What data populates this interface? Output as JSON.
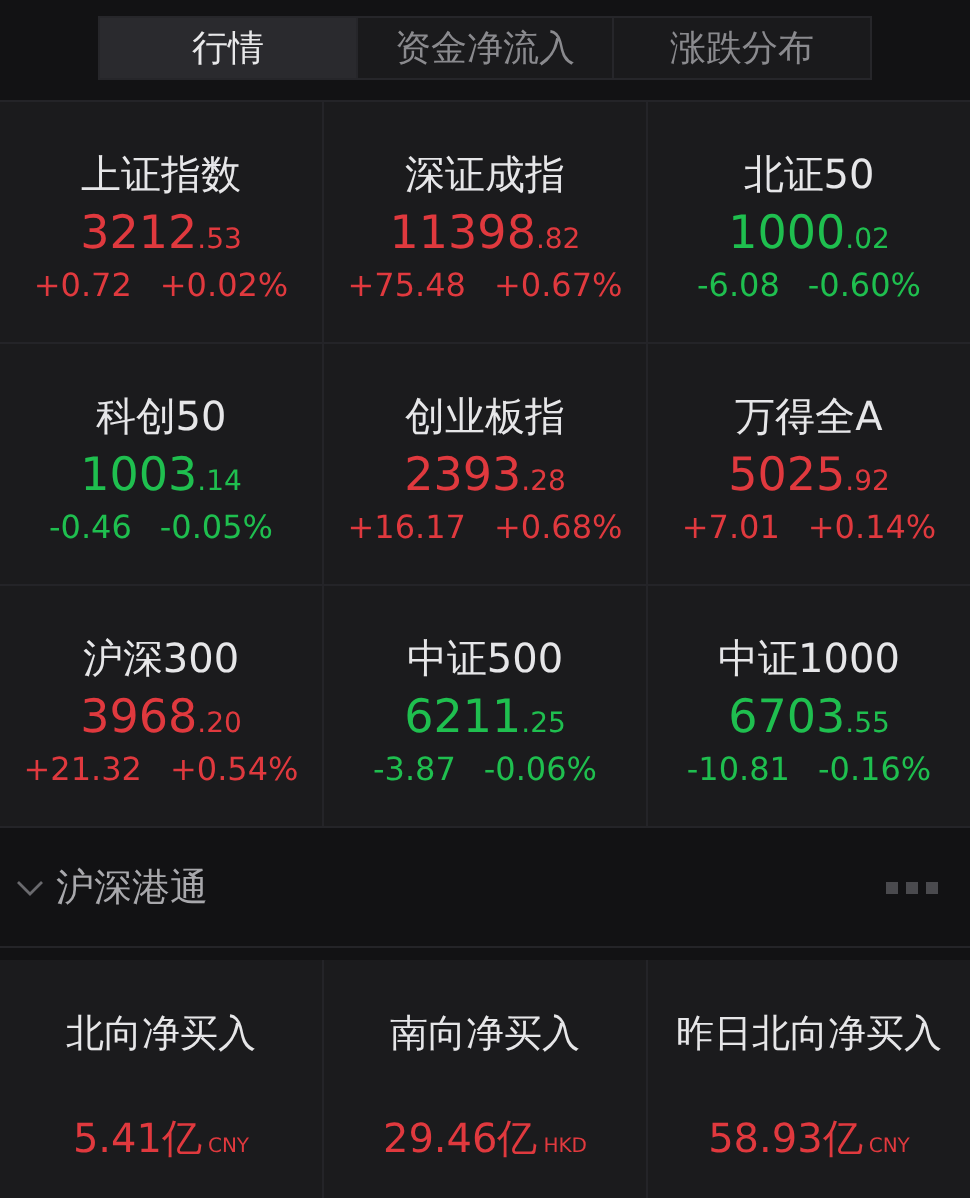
{
  "tabs": [
    {
      "label": "行情",
      "selected": true
    },
    {
      "label": "资金净流入",
      "selected": false
    },
    {
      "label": "涨跌分布",
      "selected": false
    }
  ],
  "indices": [
    {
      "name": "上证指数",
      "price": "3212",
      "price_decimal": ".53",
      "change": "+0.72",
      "percent": "+0.02%",
      "color": "#e0393e"
    },
    {
      "name": "深证成指",
      "price": "11398",
      "price_decimal": ".82",
      "change": "+75.48",
      "percent": "+0.67%",
      "color": "#e0393e"
    },
    {
      "name": "北证50",
      "price": "1000",
      "price_decimal": ".02",
      "change": "-6.08",
      "percent": "-0.60%",
      "color": "#1fbf4f"
    },
    {
      "name": "科创50",
      "price": "1003",
      "price_decimal": ".14",
      "change": "-0.46",
      "percent": "-0.05%",
      "color": "#1fbf4f"
    },
    {
      "name": "创业板指",
      "price": "2393",
      "price_decimal": ".28",
      "change": "+16.17",
      "percent": "+0.68%",
      "color": "#e0393e"
    },
    {
      "name": "万得全A",
      "price": "5025",
      "price_decimal": ".92",
      "change": "+7.01",
      "percent": "+0.14%",
      "color": "#e0393e"
    },
    {
      "name": "沪深300",
      "price": "3968",
      "price_decimal": ".20",
      "change": "+21.32",
      "percent": "+0.54%",
      "color": "#e0393e"
    },
    {
      "name": "中证500",
      "price": "6211",
      "price_decimal": ".25",
      "change": "-3.87",
      "percent": "-0.06%",
      "color": "#1fbf4f"
    },
    {
      "name": "中证1000",
      "price": "6703",
      "price_decimal": ".55",
      "change": "-10.81",
      "percent": "-0.16%",
      "color": "#1fbf4f"
    }
  ],
  "section": {
    "title": "沪深港通",
    "expanded": true
  },
  "flows": [
    {
      "label": "北向净买入",
      "amount": "5.41亿",
      "currency": "CNY"
    },
    {
      "label": "南向净买入",
      "amount": "29.46亿",
      "currency": "HKD"
    },
    {
      "label": "昨日北向净买入",
      "amount": "58.93亿",
      "currency": "CNY"
    }
  ]
}
